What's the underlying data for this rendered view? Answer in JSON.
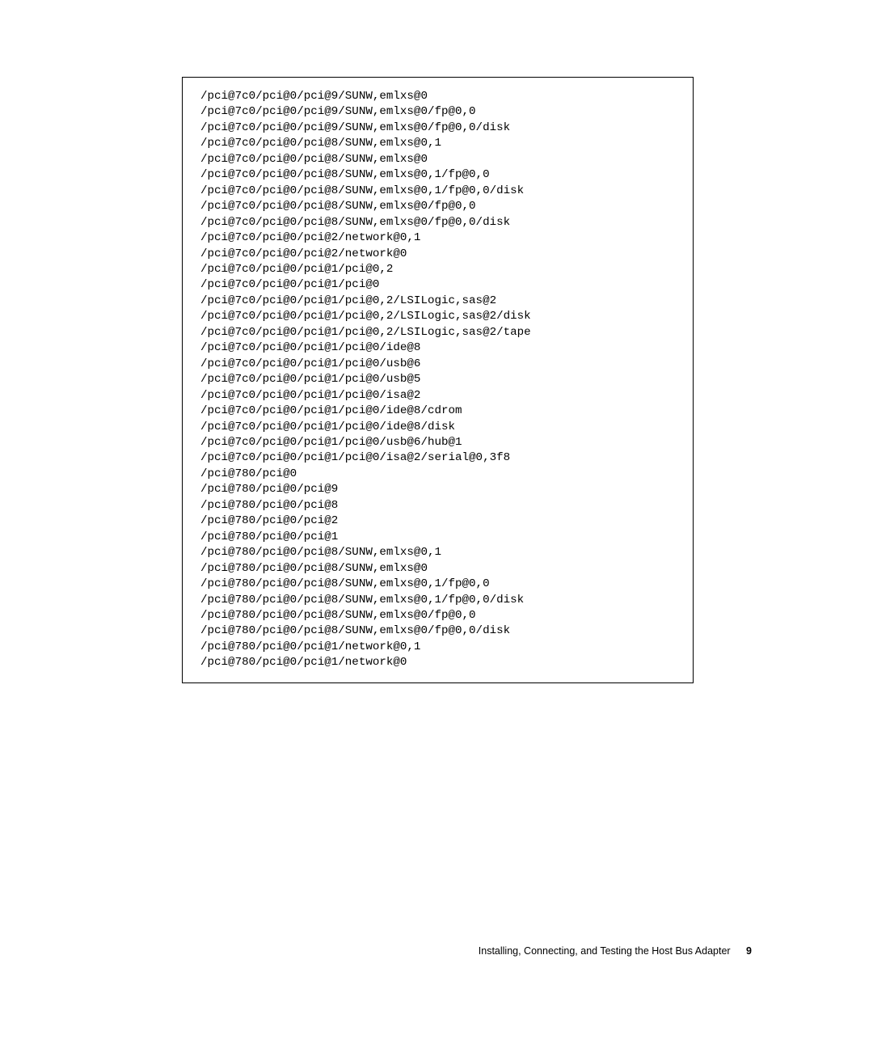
{
  "code_lines": [
    "/pci@7c0/pci@0/pci@9/SUNW,emlxs@0",
    "/pci@7c0/pci@0/pci@9/SUNW,emlxs@0/fp@0,0",
    "/pci@7c0/pci@0/pci@9/SUNW,emlxs@0/fp@0,0/disk",
    "/pci@7c0/pci@0/pci@8/SUNW,emlxs@0,1",
    "/pci@7c0/pci@0/pci@8/SUNW,emlxs@0",
    "/pci@7c0/pci@0/pci@8/SUNW,emlxs@0,1/fp@0,0",
    "/pci@7c0/pci@0/pci@8/SUNW,emlxs@0,1/fp@0,0/disk",
    "/pci@7c0/pci@0/pci@8/SUNW,emlxs@0/fp@0,0",
    "/pci@7c0/pci@0/pci@8/SUNW,emlxs@0/fp@0,0/disk",
    "/pci@7c0/pci@0/pci@2/network@0,1",
    "/pci@7c0/pci@0/pci@2/network@0",
    "/pci@7c0/pci@0/pci@1/pci@0,2",
    "/pci@7c0/pci@0/pci@1/pci@0",
    "/pci@7c0/pci@0/pci@1/pci@0,2/LSILogic,sas@2",
    "/pci@7c0/pci@0/pci@1/pci@0,2/LSILogic,sas@2/disk",
    "/pci@7c0/pci@0/pci@1/pci@0,2/LSILogic,sas@2/tape",
    "/pci@7c0/pci@0/pci@1/pci@0/ide@8",
    "/pci@7c0/pci@0/pci@1/pci@0/usb@6",
    "/pci@7c0/pci@0/pci@1/pci@0/usb@5",
    "/pci@7c0/pci@0/pci@1/pci@0/isa@2",
    "/pci@7c0/pci@0/pci@1/pci@0/ide@8/cdrom",
    "/pci@7c0/pci@0/pci@1/pci@0/ide@8/disk",
    "/pci@7c0/pci@0/pci@1/pci@0/usb@6/hub@1",
    "/pci@7c0/pci@0/pci@1/pci@0/isa@2/serial@0,3f8",
    "/pci@780/pci@0",
    "/pci@780/pci@0/pci@9",
    "/pci@780/pci@0/pci@8",
    "/pci@780/pci@0/pci@2",
    "/pci@780/pci@0/pci@1",
    "/pci@780/pci@0/pci@8/SUNW,emlxs@0,1",
    "/pci@780/pci@0/pci@8/SUNW,emlxs@0",
    "/pci@780/pci@0/pci@8/SUNW,emlxs@0,1/fp@0,0",
    "/pci@780/pci@0/pci@8/SUNW,emlxs@0,1/fp@0,0/disk",
    "/pci@780/pci@0/pci@8/SUNW,emlxs@0/fp@0,0",
    "/pci@780/pci@0/pci@8/SUNW,emlxs@0/fp@0,0/disk",
    "/pci@780/pci@0/pci@1/network@0,1",
    "/pci@780/pci@0/pci@1/network@0"
  ],
  "footer": {
    "text": "Installing, Connecting, and Testing the Host Bus Adapter",
    "page": "9"
  }
}
